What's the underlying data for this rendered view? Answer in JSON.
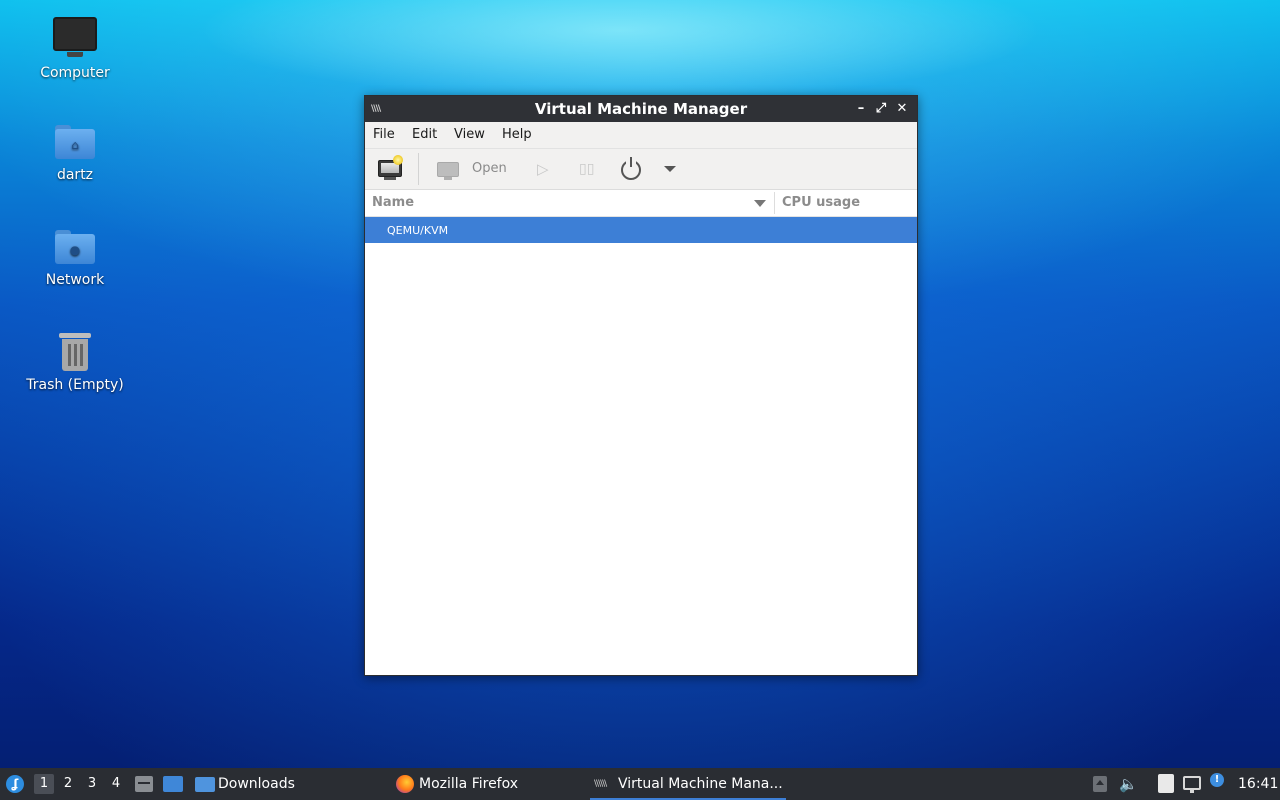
{
  "desktop": {
    "icons": [
      {
        "label": "Computer",
        "icon": "computer-icon"
      },
      {
        "label": "dartz",
        "icon": "home-folder-icon"
      },
      {
        "label": "Network",
        "icon": "network-folder-icon"
      },
      {
        "label": "Trash (Empty)",
        "icon": "trash-icon"
      }
    ]
  },
  "window": {
    "title": "Virtual Machine Manager",
    "app_icon": "vmm-icon",
    "controls": {
      "minimize": "minimize-icon",
      "maximize": "maximize-icon",
      "close": "close-icon"
    },
    "menu": [
      "File",
      "Edit",
      "View",
      "Help"
    ],
    "toolbar": {
      "new_vm_icon": "new-vm-icon",
      "open_label": "Open",
      "run_icon": "play-icon",
      "pause_icon": "pause-icon",
      "shutdown_icon": "power-icon",
      "shutdown_menu_icon": "dropdown-arrow-icon"
    },
    "list": {
      "columns": [
        "Name",
        "CPU usage"
      ],
      "rows": [
        {
          "name": "QEMU/KVM",
          "selected": true
        }
      ]
    }
  },
  "taskbar": {
    "workspaces": [
      "1",
      "2",
      "3",
      "4"
    ],
    "active_workspace": "1",
    "tasks": [
      {
        "label": "Downloads",
        "icon": "folder-icon"
      },
      {
        "label": "Mozilla Firefox",
        "icon": "firefox-icon"
      },
      {
        "label": "Virtual Machine Mana...",
        "icon": "vmm-icon",
        "active": true
      }
    ],
    "clock": "16:41"
  },
  "colors": {
    "selection": "#3d7fd6",
    "titlebar": "#2f3136",
    "taskbar": "#2a2d33"
  }
}
